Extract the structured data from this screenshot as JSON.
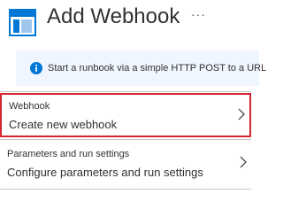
{
  "header": {
    "title": "Add Webhook",
    "more_label": "···"
  },
  "info": {
    "text": "Start a runbook via a simple HTTP POST to a URL"
  },
  "items": [
    {
      "label": "Webhook",
      "value": "Create new webhook",
      "selected": true
    },
    {
      "label": "Parameters and run settings",
      "value": "Configure parameters and run settings",
      "selected": false
    }
  ],
  "colors": {
    "accent_blue": "#0078d4",
    "selection_red": "#d7262f",
    "banner_bg": "#f0f6ff"
  }
}
